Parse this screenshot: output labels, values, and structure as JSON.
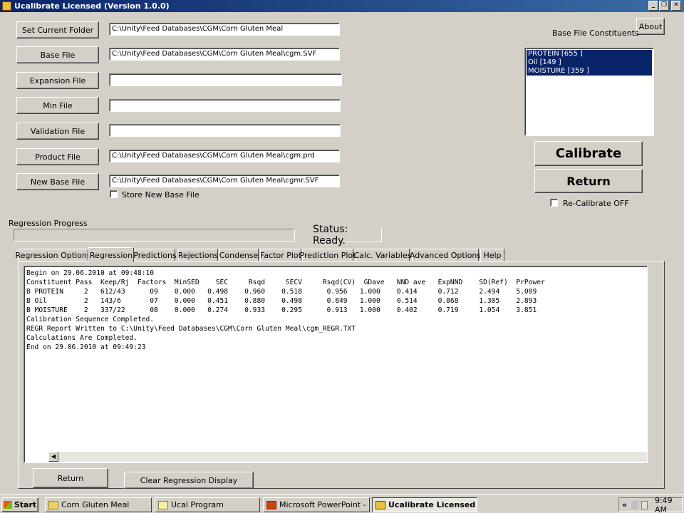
{
  "window": {
    "title": "Ucalibrate Licensed (Version 1.0.0)",
    "minimize": "_",
    "restore": "❐",
    "close": "✕"
  },
  "files": {
    "set_folder_label": "Set Current Folder",
    "set_folder_value": "C:\\Unity\\Feed Databases\\CGM\\Corn Gluten Meal",
    "base_file_label": "Base File",
    "base_file_value": "C:\\Unity\\Feed Databases\\CGM\\Corn Gluten Meal\\cgm.SVF",
    "expansion_file_label": "Expansion File",
    "expansion_file_value": "",
    "min_file_label": "Min File",
    "min_file_value": "",
    "validation_file_label": "Validation File",
    "validation_file_value": "",
    "product_file_label": "Product File",
    "product_file_value": "C:\\Unity\\Feed Databases\\CGM\\Corn Gluten Meal\\cgm.prd",
    "new_base_file_label": "New Base File",
    "new_base_file_value": "C:\\Unity\\Feed Databases\\CGM\\Corn Gluten Meal\\cgmr.SVF",
    "store_new_base_label": "Store New Base File"
  },
  "right_panel": {
    "about_label": "About",
    "constituents_title": "Base File Constituents",
    "constituents": [
      "PROTEIN [655 ]",
      "Oil [149 ]",
      "MOISTURE [359 ]"
    ],
    "calibrate_label": "Calibrate",
    "return_label": "Return",
    "recalibrate_label": "Re-Calibrate OFF"
  },
  "progress": {
    "title": "Regression Progress",
    "status": "Status: Ready."
  },
  "tabs": [
    "Regression Options",
    "Regression",
    "Predictions",
    "Rejections",
    "Condense",
    "Factor Plot",
    "Prediction Plot",
    "Calc. Variables",
    "Advanced Options",
    "Help"
  ],
  "active_tab": "Regression",
  "output": {
    "text": "Begin on 29.06.2010 at 09:48:10\nConstituent Pass  Keep/Rj  Factors  MinSED    SEC     Rsqd     SECV     Rsqd(CV)  GDave   NND ave   ExpNND    SD(Ref)  PrPower\nB PROTEIN     2   612/43      09    0.000   0.498    0.960    0.518      0.956   1.000    0.414     0.712     2.494    5.009\nB Oil         2   143/6       07    0.000   0.451    0.880    0.498      0.849   1.000    0.514     0.868     1.305    2.893\nB MOISTURE    2   337/22      08    0.000   0.274    0.933    0.295      0.913   1.000    0.402     0.719     1.054    3.851\nCalibration Sequence Completed.\nREGR Report Written to C:\\Unity\\Feed Databases\\CGM\\Corn Gluten Meal\\cgm_REGR.TXT\nCalculations Are Completed.\nEnd on 29.06.2010 at 09:49:23"
  },
  "bottom": {
    "return_label": "Return",
    "clear_label": "Clear Regression Display"
  },
  "taskbar": {
    "start": "Start",
    "tasks": [
      "Corn Gluten Meal",
      "Ucal Program",
      "Microsoft PowerPoint - [...",
      "Ucalibrate Licensed (..."
    ],
    "chevron": "«",
    "time": "9:49 AM"
  }
}
